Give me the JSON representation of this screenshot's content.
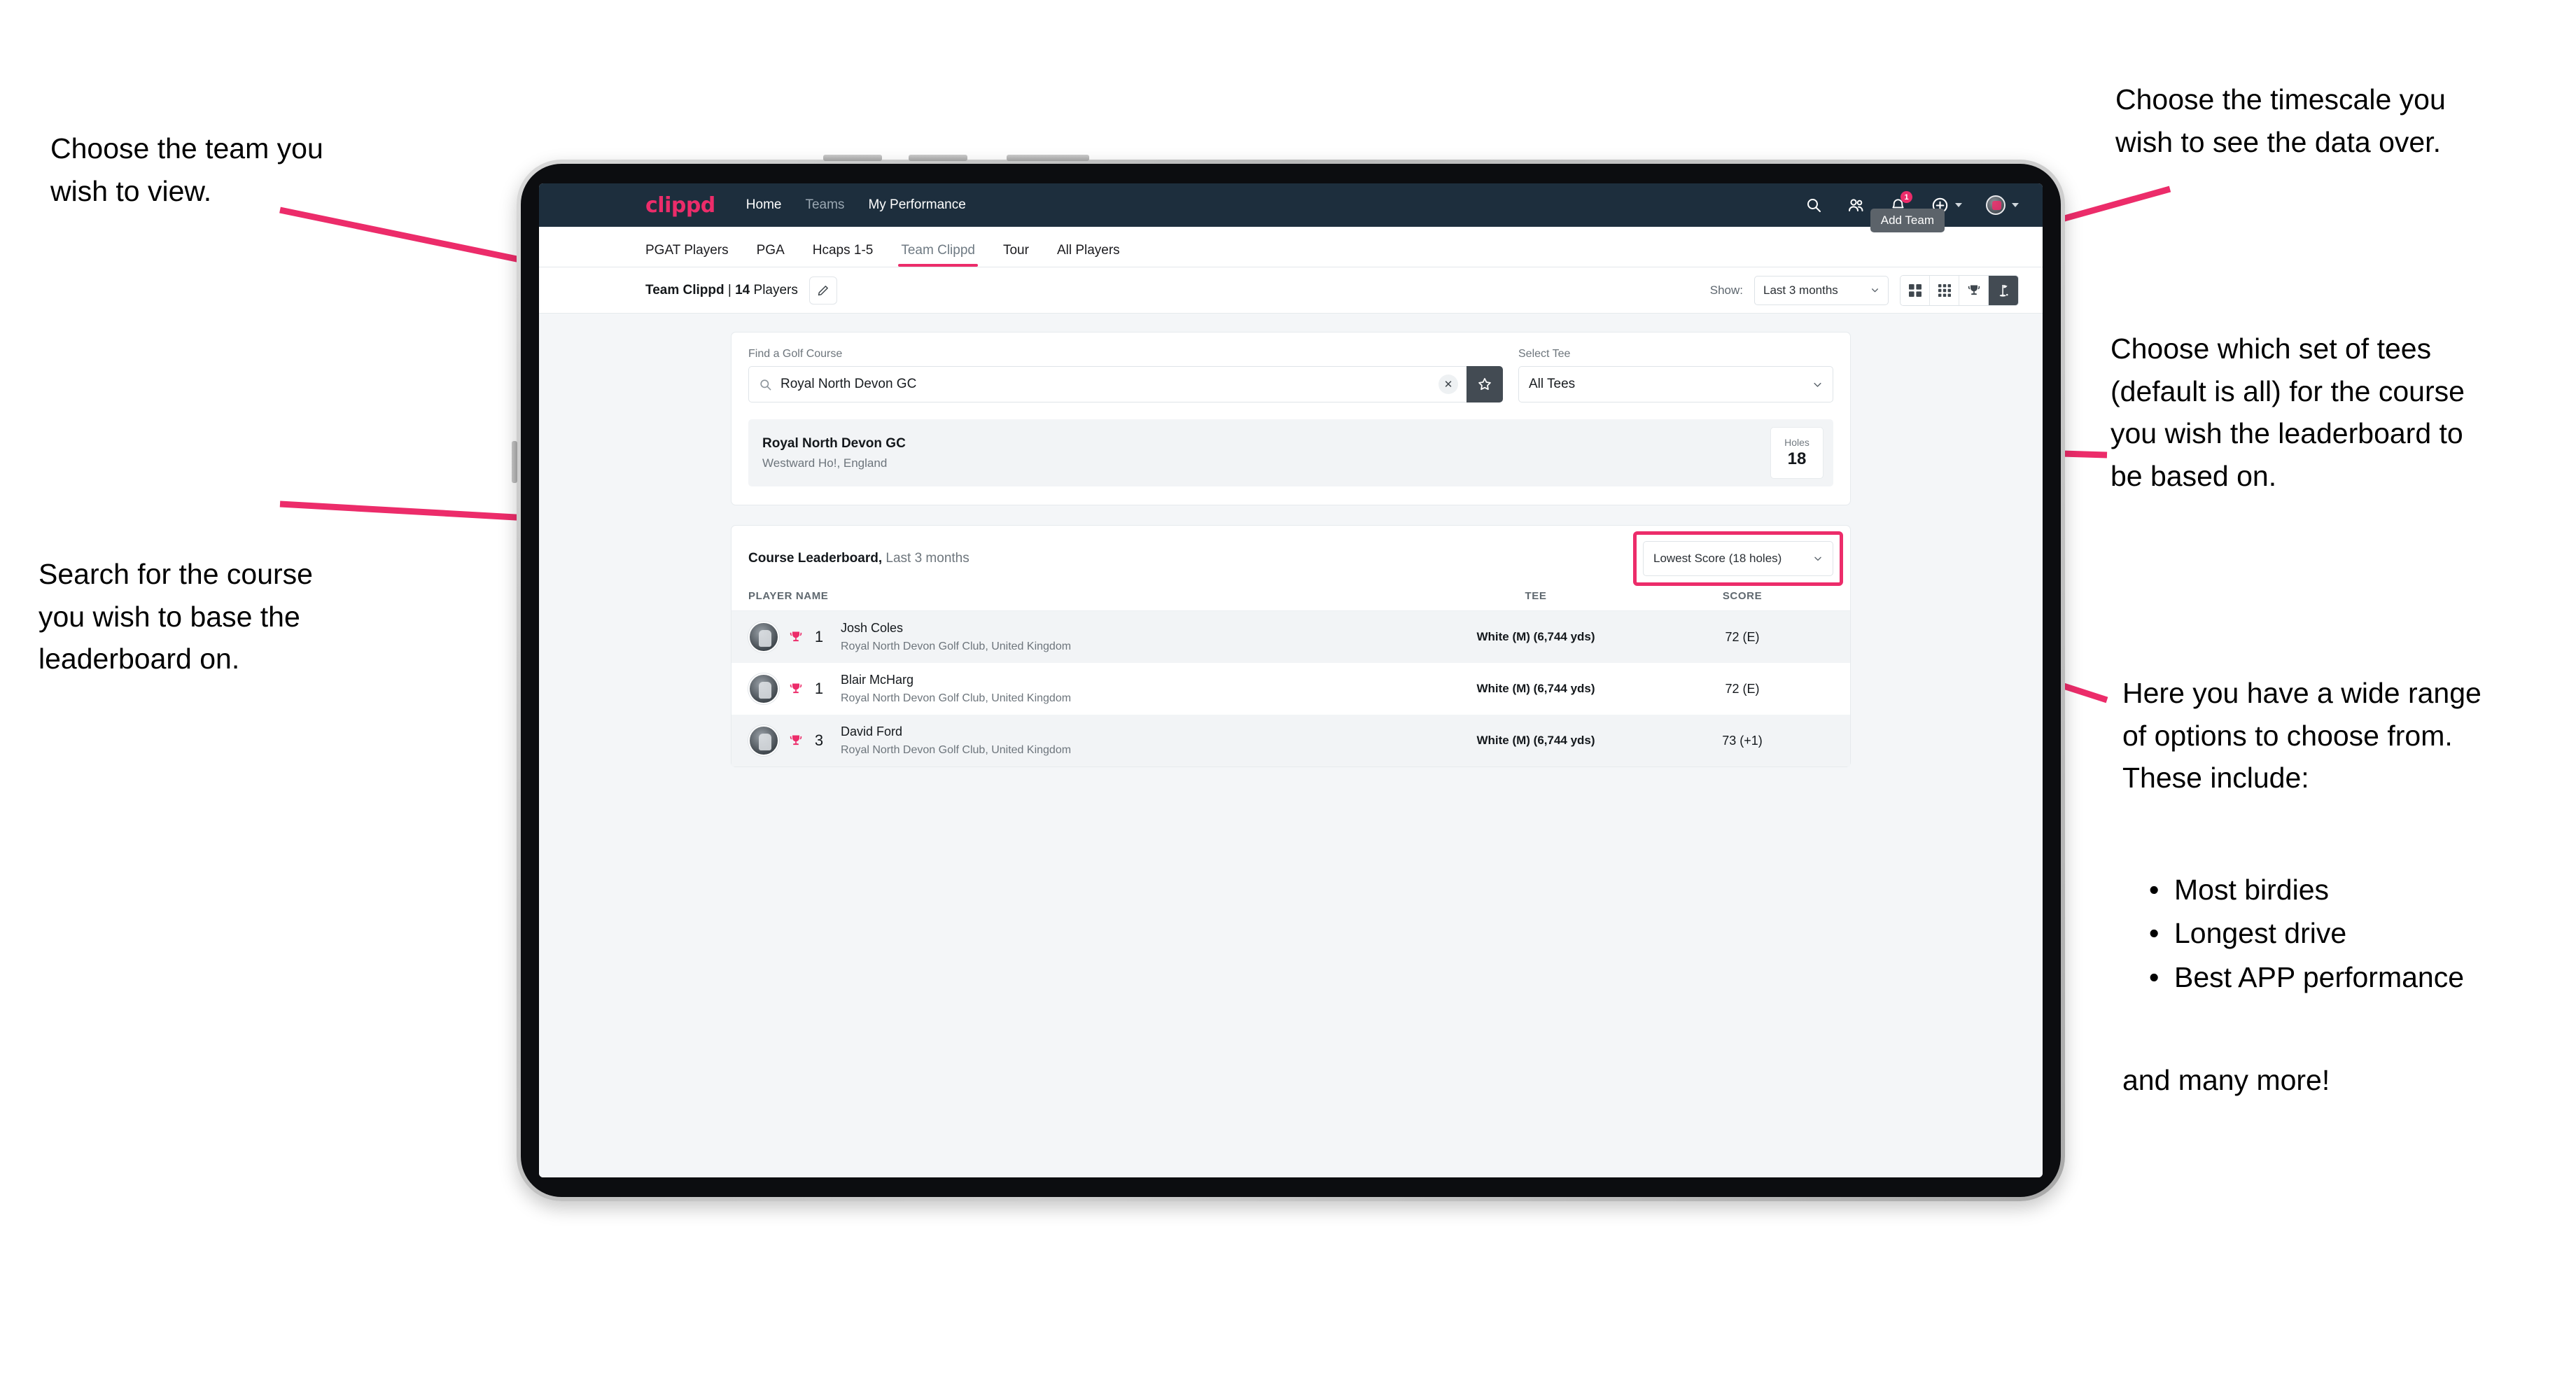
{
  "annotations": {
    "left_top": "Choose the team you\nwish to view.",
    "left_bottom": "Search for the course\nyou wish to base the\nleaderboard on.",
    "right_top": "Choose the timescale you\nwish to see the data over.",
    "right_mid": "Choose which set of tees\n(default is all) for the course\nyou wish the leaderboard to\nbe based on.",
    "right_bottom_intro": "Here you have a wide range\nof options to choose from.\nThese include:",
    "right_bullets": [
      "Most birdies",
      "Longest drive",
      "Best APP performance"
    ],
    "right_tail": "and many more!"
  },
  "topnav": {
    "brand": "clippd",
    "links": [
      {
        "label": "Home",
        "dim": false
      },
      {
        "label": "Teams",
        "dim": true
      },
      {
        "label": "My Performance",
        "dim": false
      }
    ],
    "icons": [
      "search-icon",
      "people-icon",
      "bell-icon",
      "plus-circle-icon",
      "avatar-icon"
    ],
    "notification_count": "1"
  },
  "tabs": {
    "items": [
      {
        "label": "PGAT Players",
        "active": false
      },
      {
        "label": "PGA",
        "active": false
      },
      {
        "label": "Hcaps 1-5",
        "active": false
      },
      {
        "label": "Team Clippd",
        "active": true
      },
      {
        "label": "Tour",
        "active": false
      },
      {
        "label": "All Players",
        "active": false
      }
    ],
    "tooltip": "Add Team"
  },
  "filterbar": {
    "team_name": "Team Clippd",
    "separator": " | ",
    "player_count": "14",
    "players_word": " Players",
    "edit_icon": "pencil-icon",
    "show_label": "Show:",
    "timescale_value": "Last 3 months",
    "view_buttons": [
      {
        "name": "grid-2x2-icon",
        "active": false
      },
      {
        "name": "grid-3x3-icon",
        "active": false
      },
      {
        "name": "trophy-icon",
        "active": false
      },
      {
        "name": "golf-flag-icon",
        "active": true
      }
    ]
  },
  "search_card": {
    "course_label": "Find a Golf Course",
    "course_value": "Royal North Devon GC",
    "course_placeholder": "Find a Golf Course",
    "clear_icon": "close-icon",
    "favorite_icon": "star-icon",
    "tee_label": "Select Tee",
    "tee_value": "All Tees",
    "course_result": {
      "name": "Royal North Devon GC",
      "location": "Westward Ho!, England",
      "holes_label": "Holes",
      "holes_value": "18"
    }
  },
  "leaderboard": {
    "title": "Course Leaderboard,",
    "subtitle": " Last 3 months",
    "sort_value": "Lowest Score (18 holes)",
    "columns": [
      "PLAYER NAME",
      "TEE",
      "SCORE"
    ],
    "rows": [
      {
        "rank": "1",
        "name": "Josh Coles",
        "club": "Royal North Devon Golf Club, United Kingdom",
        "tee": "White (M) (6,744 yds)",
        "score": "72 (E)"
      },
      {
        "rank": "1",
        "name": "Blair McHarg",
        "club": "Royal North Devon Golf Club, United Kingdom",
        "tee": "White (M) (6,744 yds)",
        "score": "72 (E)"
      },
      {
        "rank": "3",
        "name": "David Ford",
        "club": "Royal North Devon Golf Club, United Kingdom",
        "tee": "White (M) (6,744 yds)",
        "score": "73 (+1)"
      }
    ]
  },
  "colors": {
    "accent_pink": "#ec2c6a",
    "nav_dark": "#1d2e3d",
    "page_bg": "#f4f6f8",
    "active_dark": "#434b53"
  }
}
